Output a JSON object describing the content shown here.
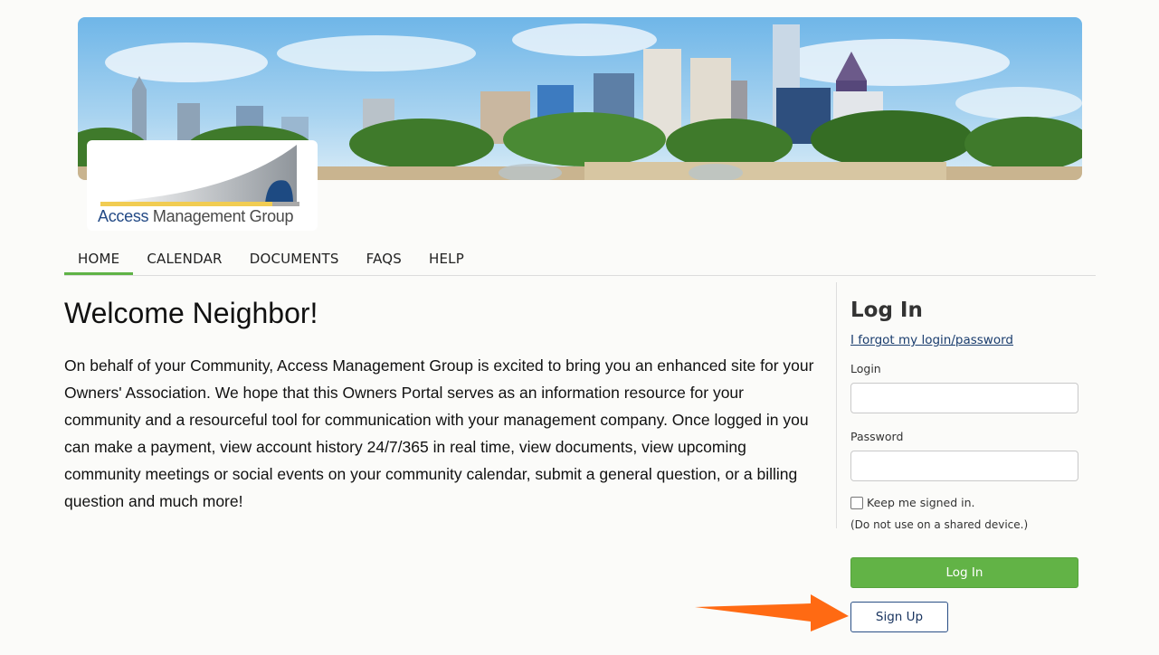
{
  "logo": {
    "word1": "Access",
    "word2": "Management Group"
  },
  "nav": {
    "items": [
      {
        "label": "HOME",
        "active": true
      },
      {
        "label": "CALENDAR"
      },
      {
        "label": "DOCUMENTS"
      },
      {
        "label": "FAQS"
      },
      {
        "label": "HELP"
      }
    ],
    "accent": "#5fb346"
  },
  "main": {
    "title": "Welcome Neighbor!",
    "body": "On behalf of your Community, Access Management Group is excited to bring you an enhanced site for your Owners' Association. We hope that this Owners Portal serves as an information resource for your community and a resourceful tool for communication with your management company. Once logged in you can make a payment, view account history 24/7/365 in real time, view documents, view upcoming community meetings or social events on your community calendar, submit a general question, or a billing question and much more!"
  },
  "login": {
    "title": "Log In",
    "forgot_link": "I forgot my login/password",
    "login_label": "Login",
    "login_value": "",
    "password_label": "Password",
    "password_value": "",
    "keep_signed_in": "Keep me signed in.",
    "keep_checked": false,
    "shared_note": "(Do not use on a shared device.)",
    "login_button": "Log In",
    "signup_button": "Sign Up",
    "login_button_color": "#62b346",
    "signup_border_color": "#2a4f86"
  },
  "annotation": {
    "arrow_color": "#ff6a13"
  }
}
